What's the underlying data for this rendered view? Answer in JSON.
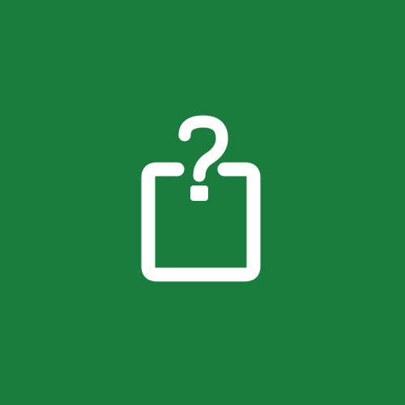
{
  "tile": {
    "background_color": "#1a7c3e",
    "foreground_color": "#ffffff",
    "icon": "question-box-icon"
  }
}
